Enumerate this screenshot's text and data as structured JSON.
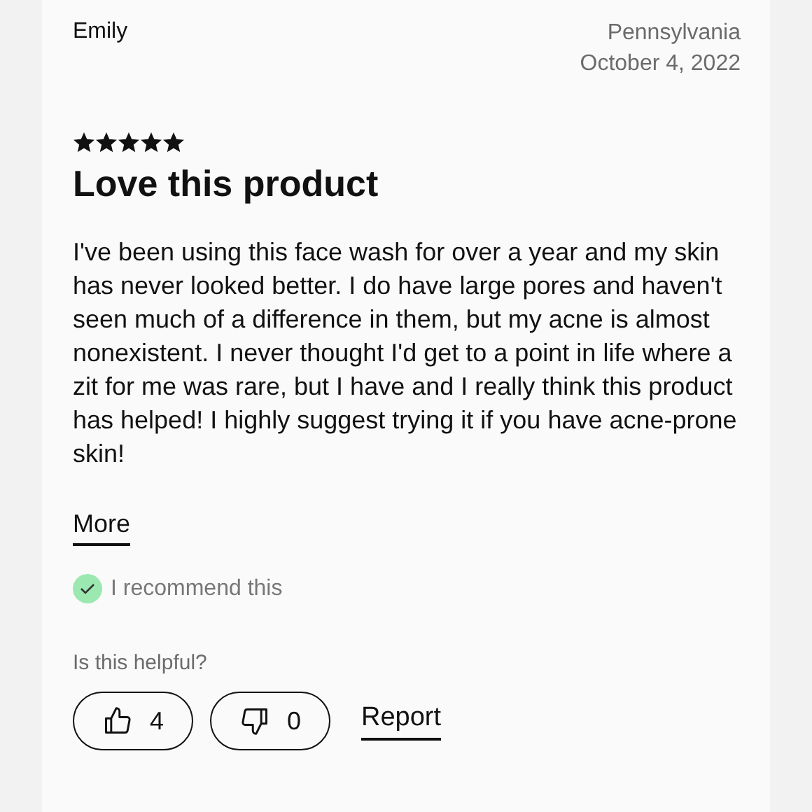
{
  "review": {
    "author": "Emily",
    "location": "Pennsylvania",
    "date": "October 4, 2022",
    "stars": 5,
    "title": "Love this product",
    "body": "I've been using this face wash for over a year and my skin has never looked better. I do have large pores and haven't seen much of a difference in them, but my acne is almost nonexistent. I never thought I'd get to a point in life where a zit for me was rare, but I have and I really think this product has helped! I highly suggest trying it if you have acne-prone skin!",
    "more_link": "More",
    "recommended": true,
    "recommend_text": "I recommend this",
    "helpful_prompt": "Is this helpful?",
    "helpful_count": "4",
    "unhelpful_count": "0",
    "report_link": "Report"
  }
}
